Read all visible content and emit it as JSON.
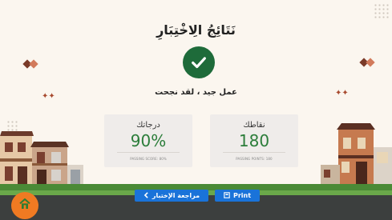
{
  "title": "نَتَائِجُ الِاخْتِبَارِ",
  "success_message": "عمل جيد ، لقد نجحت",
  "cards": {
    "points": {
      "label": "نقاطك",
      "value": "180",
      "footnote": "PASSING POINTS: 180"
    },
    "score": {
      "label": "درجاتك",
      "value": "90%",
      "footnote": "PASSING SCORE: 80%"
    }
  },
  "buttons": {
    "review_label": "مراجعة الإختبار",
    "print_label": "Print"
  },
  "colors": {
    "background": "#fbf6ef",
    "success": "#1e6b3a",
    "value_text": "#2b7d3a",
    "button": "#1a73d9",
    "home": "#f07a22"
  },
  "icons": {
    "check": "check-icon",
    "review": "chevron-left-icon",
    "print": "print-icon",
    "home": "home-icon"
  }
}
